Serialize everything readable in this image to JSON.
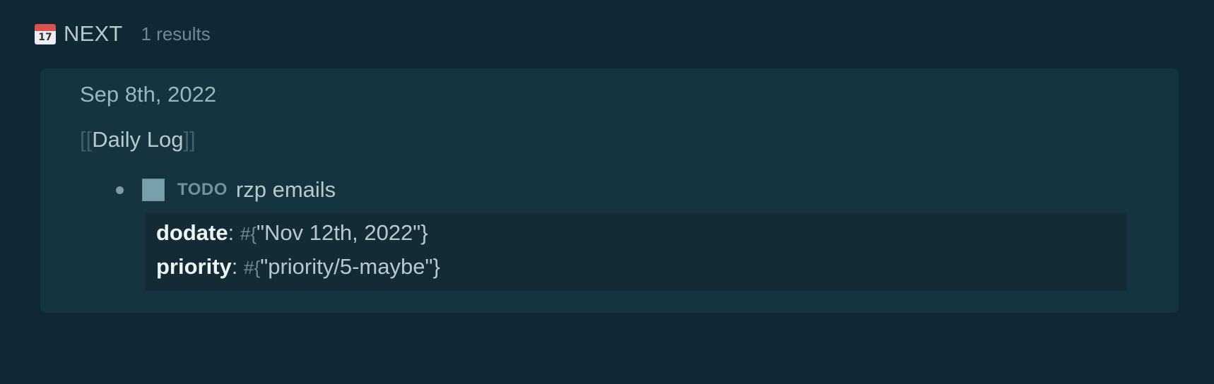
{
  "query": {
    "icon": "calendar-icon",
    "icon_day": "17",
    "title": "NEXT",
    "count_label": "1 results"
  },
  "result": {
    "page_date": "Sep 8th, 2022",
    "page_ref": {
      "open_bracket": "[[",
      "name": "Daily Log",
      "close_bracket": "]]"
    },
    "block": {
      "marker": "TODO",
      "text": "rzp emails",
      "properties": [
        {
          "key": "dodate",
          "colon": ":",
          "hash": "#{",
          "value": "\"Nov 12th, 2022\"}"
        },
        {
          "key": "priority",
          "colon": ":",
          "hash": "#{",
          "value": "\"priority/5-maybe\"}"
        }
      ]
    }
  },
  "colors": {
    "background": "#0f2833",
    "card": "#15343f",
    "properties_bg": "#142b36",
    "checkbox": "#78a0aa",
    "calendar_red": "#d9534f"
  }
}
